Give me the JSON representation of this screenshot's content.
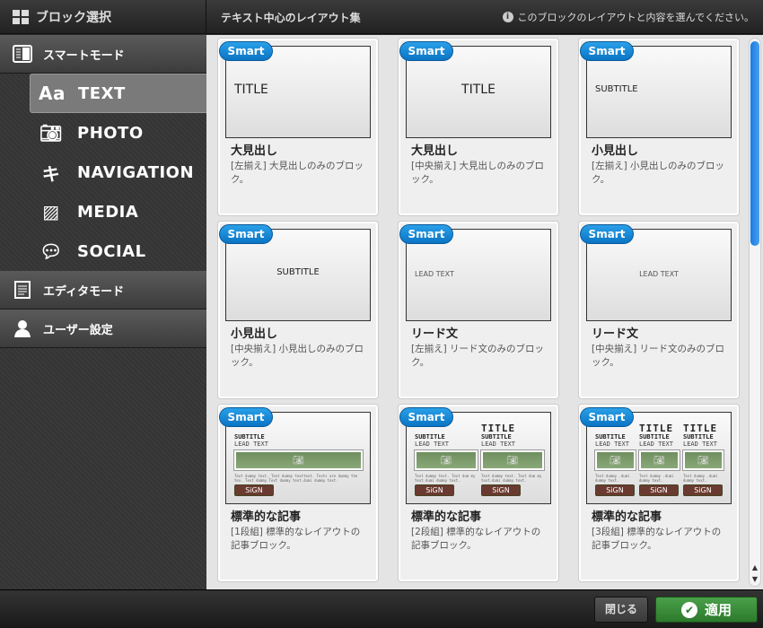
{
  "header": {
    "title": "ブロック選択",
    "section_title": "テキスト中心のレイアウト集",
    "hint": "このブロックのレイアウトと内容を選んでください。"
  },
  "sidebar": {
    "smart_mode": "スマートモード",
    "items": [
      {
        "label": "TEXT",
        "icon": "text-aa-icon",
        "glyph": "Aa",
        "selected": true
      },
      {
        "label": "PHOTO",
        "icon": "camera-icon",
        "glyph": "📷︎",
        "selected": false
      },
      {
        "label": "NAVIGATION",
        "icon": "signpost-icon",
        "glyph": "キ",
        "selected": false
      },
      {
        "label": "MEDIA",
        "icon": "image-icon",
        "glyph": "▨",
        "selected": false
      },
      {
        "label": "SOCIAL",
        "icon": "speech-bubbles-icon",
        "glyph": "💬︎",
        "selected": false
      }
    ],
    "editor_mode": "エディタモード",
    "user_settings": "ユーザー設定"
  },
  "badge": "Smart",
  "thumb_text": {
    "title": "TITLE",
    "subtitle": "SUBTITLE",
    "lead": "LEAD TEXT",
    "sign": "SiGN",
    "dummy1": "Text dummy text. Text dummy texttext. Texts are dummy the tex. Text dummy Text dummy text.dumi dummy text.",
    "dummy2": "Text dummy text. Text dum my text.dumi dummy text.",
    "dummy3": "Text dummy .dumi dummy text."
  },
  "cards": [
    {
      "title": "大見出し",
      "desc": "[左揃え] 大見出しのみのブロック。",
      "kind": "title-left"
    },
    {
      "title": "大見出し",
      "desc": "[中央揃え] 大見出しのみのブロック。",
      "kind": "title-center"
    },
    {
      "title": "小見出し",
      "desc": "[左揃え] 小見出しのみのブロック。",
      "kind": "subtitle-left"
    },
    {
      "title": "小見出し",
      "desc": "[中央揃え] 小見出しのみのブロック。",
      "kind": "subtitle-center"
    },
    {
      "title": "リード文",
      "desc": "[左揃え] リード文のみのブロック。",
      "kind": "lead-left"
    },
    {
      "title": "リード文",
      "desc": "[中央揃え] リード文のみのブロック。",
      "kind": "lead-center"
    },
    {
      "title": "標準的な記事",
      "desc": "[1段組] 標準的なレイアウトの\n記事ブロック。",
      "kind": "article-1"
    },
    {
      "title": "標準的な記事",
      "desc": "[2段組] 標準的なレイアウトの\n記事ブロック。",
      "kind": "article-2"
    },
    {
      "title": "標準的な記事",
      "desc": "[3段組] 標準的なレイアウトの\n記事ブロック。",
      "kind": "article-3"
    }
  ],
  "footer": {
    "close": "閉じる",
    "apply": "適用"
  },
  "colors": {
    "badge": "#0a84d4",
    "apply": "#3a8f3a",
    "scroll_thumb": "#1a7ae0"
  }
}
